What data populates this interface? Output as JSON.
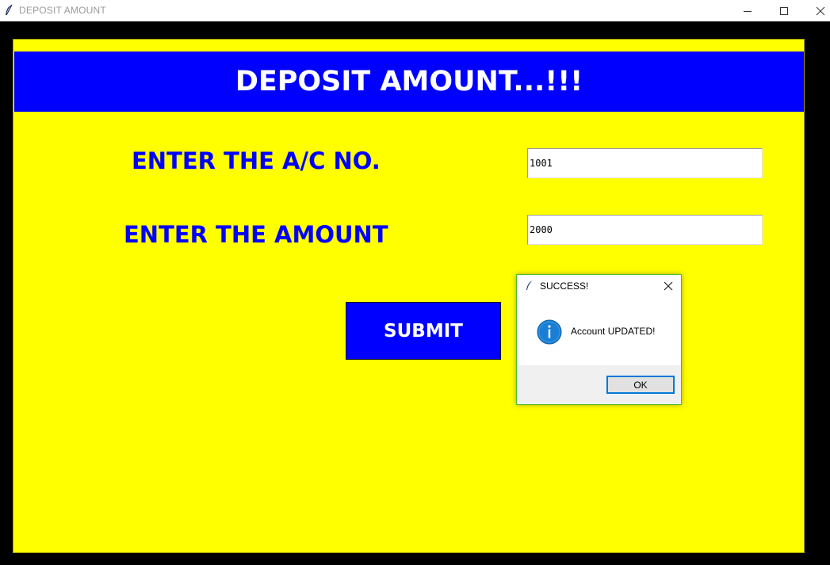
{
  "window": {
    "title": "DEPOSIT AMOUNT",
    "app_icon": "feather-icon",
    "controls": [
      "minimize-icon",
      "maximize-icon",
      "close-icon"
    ]
  },
  "form": {
    "header": "DEPOSIT AMOUNT...!!!",
    "acno_label": "ENTER THE A/C NO.",
    "acno_value": "1001",
    "amount_label": "ENTER THE AMOUNT",
    "amount_value": "2000",
    "submit_label": "SUBMIT"
  },
  "dialog": {
    "title": "SUCCESS!",
    "icon": "info-icon",
    "message": "Account UPDATED!",
    "ok_label": "OK"
  },
  "colors": {
    "frame_background": "#ffff00",
    "header_background": "#0000ff",
    "label_text": "#0000ff",
    "window_background": "#000000"
  }
}
